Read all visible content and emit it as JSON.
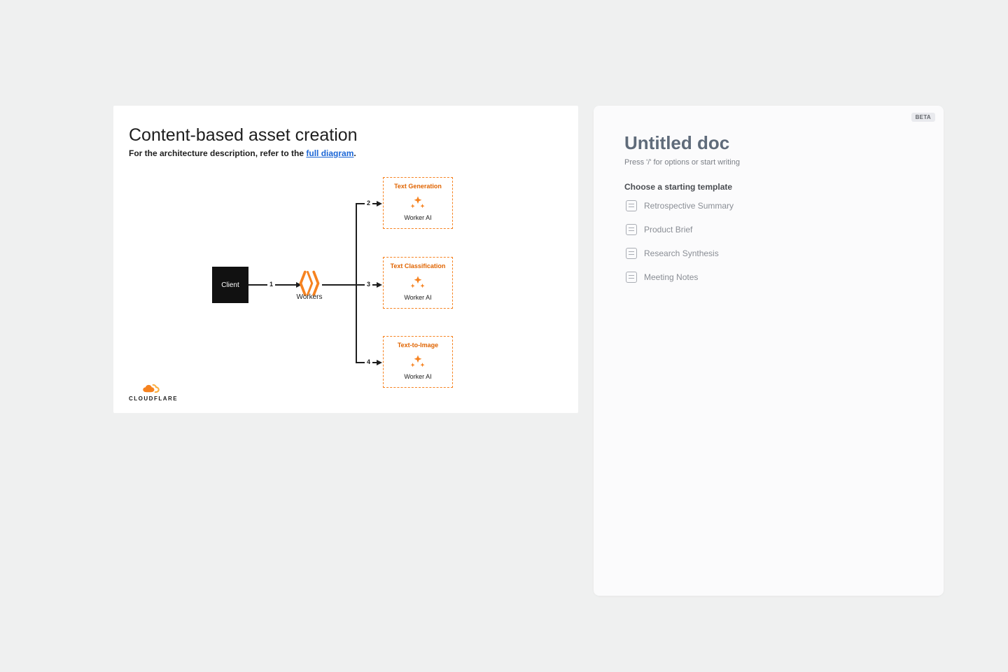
{
  "diagram": {
    "title": "Content-based asset creation",
    "subtitle_prefix": "For the architecture description, refer to the ",
    "subtitle_link": "full diagram",
    "subtitle_suffix": ".",
    "client_label": "Client",
    "workers_label": "Workers",
    "worker_ai_label": "Worker AI",
    "branches": {
      "1": {
        "title": "Text Generation"
      },
      "2": {
        "title": "Text Classification"
      },
      "3": {
        "title": "Text-to-Image"
      }
    },
    "edge_numbers": {
      "a": "1",
      "b": "2",
      "c": "3",
      "d": "4"
    },
    "brand": "CLOUDFLARE"
  },
  "doc": {
    "badge": "BETA",
    "title": "Untitled doc",
    "hint": "Press '/' for options or start writing",
    "templates_heading": "Choose a starting template",
    "templates": [
      "Retrospective Summary",
      "Product Brief",
      "Research Synthesis",
      "Meeting Notes"
    ]
  }
}
